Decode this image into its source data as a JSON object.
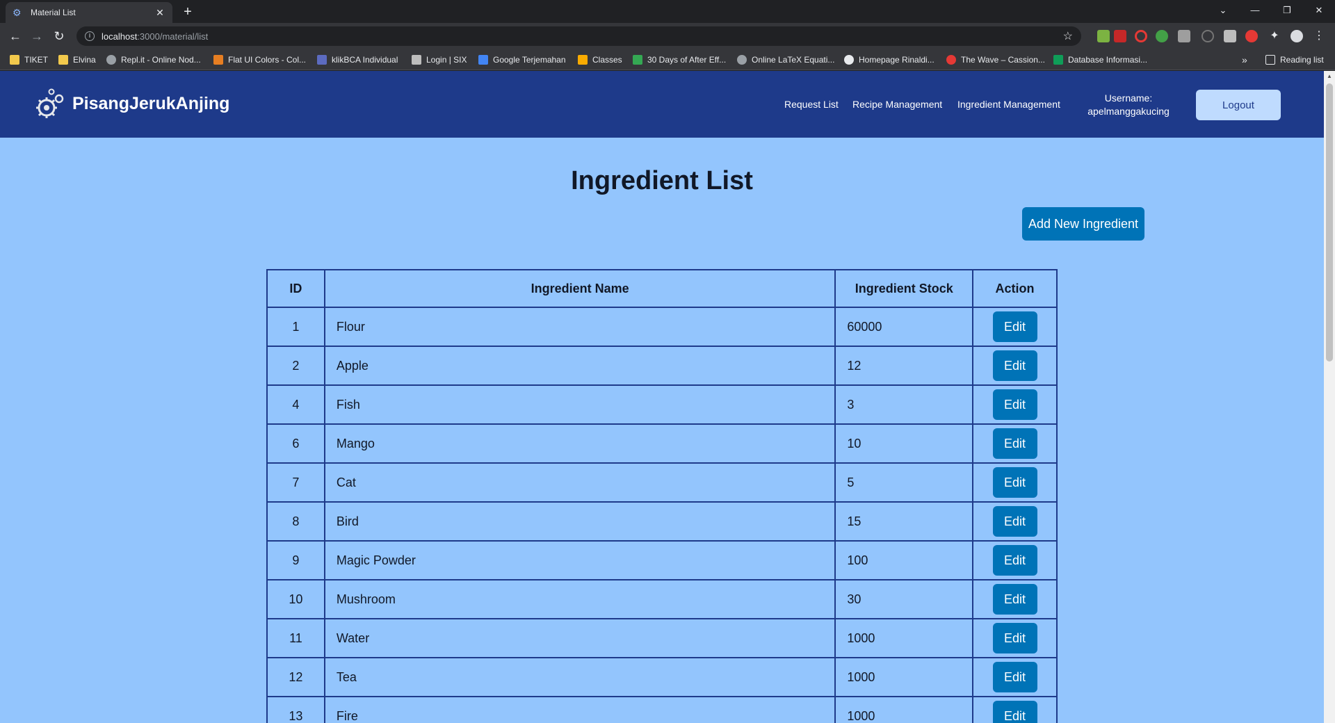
{
  "browser": {
    "tab_title": "Material List",
    "url_host": "localhost",
    "url_path": ":3000/material/list",
    "reading_list_label": "Reading list",
    "bookmarks": [
      {
        "label": "TIKET",
        "icon": "folder-icon"
      },
      {
        "label": "Elvina",
        "icon": "folder-icon"
      },
      {
        "label": "Repl.it - Online Nod...",
        "icon": "replit-icon"
      },
      {
        "label": "Flat UI Colors - Col...",
        "icon": "flatui-icon"
      },
      {
        "label": "klikBCA Individual",
        "icon": "bca-icon"
      },
      {
        "label": "Login | SIX",
        "icon": "six-icon"
      },
      {
        "label": "Google Terjemahan",
        "icon": "translate-icon"
      },
      {
        "label": "Classes",
        "icon": "classroom-icon"
      },
      {
        "label": "30 Days of After Eff...",
        "icon": "chart-icon"
      },
      {
        "label": "Online LaTeX Equati...",
        "icon": "gear-icon"
      },
      {
        "label": "Homepage Rinaldi...",
        "icon": "github-icon"
      },
      {
        "label": "The Wave – Cassion...",
        "icon": "music-icon"
      },
      {
        "label": "Database Informasi...",
        "icon": "sheets-icon"
      }
    ]
  },
  "navbar": {
    "brand": "PisangJerukAnjing",
    "links": [
      "Request List",
      "Recipe Management",
      "Ingredient Management"
    ],
    "username_label": "Username:",
    "username": "apelmanggakucing",
    "logout_label": "Logout"
  },
  "main": {
    "title": "Ingredient List",
    "add_button_label": "Add New Ingredient",
    "table": {
      "headers": [
        "ID",
        "Ingredient Name",
        "Ingredient Stock",
        "Action"
      ],
      "edit_label": "Edit",
      "rows": [
        {
          "id": "1",
          "name": "Flour",
          "stock": "60000"
        },
        {
          "id": "2",
          "name": "Apple",
          "stock": "12"
        },
        {
          "id": "4",
          "name": "Fish",
          "stock": "3"
        },
        {
          "id": "6",
          "name": "Mango",
          "stock": "10"
        },
        {
          "id": "7",
          "name": "Cat",
          "stock": "5"
        },
        {
          "id": "8",
          "name": "Bird",
          "stock": "15"
        },
        {
          "id": "9",
          "name": "Magic Powder",
          "stock": "100"
        },
        {
          "id": "10",
          "name": "Mushroom",
          "stock": "30"
        },
        {
          "id": "11",
          "name": "Water",
          "stock": "1000"
        },
        {
          "id": "12",
          "name": "Tea",
          "stock": "1000"
        },
        {
          "id": "13",
          "name": "Fire",
          "stock": "1000"
        }
      ]
    }
  },
  "colors": {
    "navbar_bg": "#1e3a8a",
    "page_bg": "#93c5fd",
    "button_blue": "#0073b7",
    "logout_bg": "#bfdbfe"
  }
}
